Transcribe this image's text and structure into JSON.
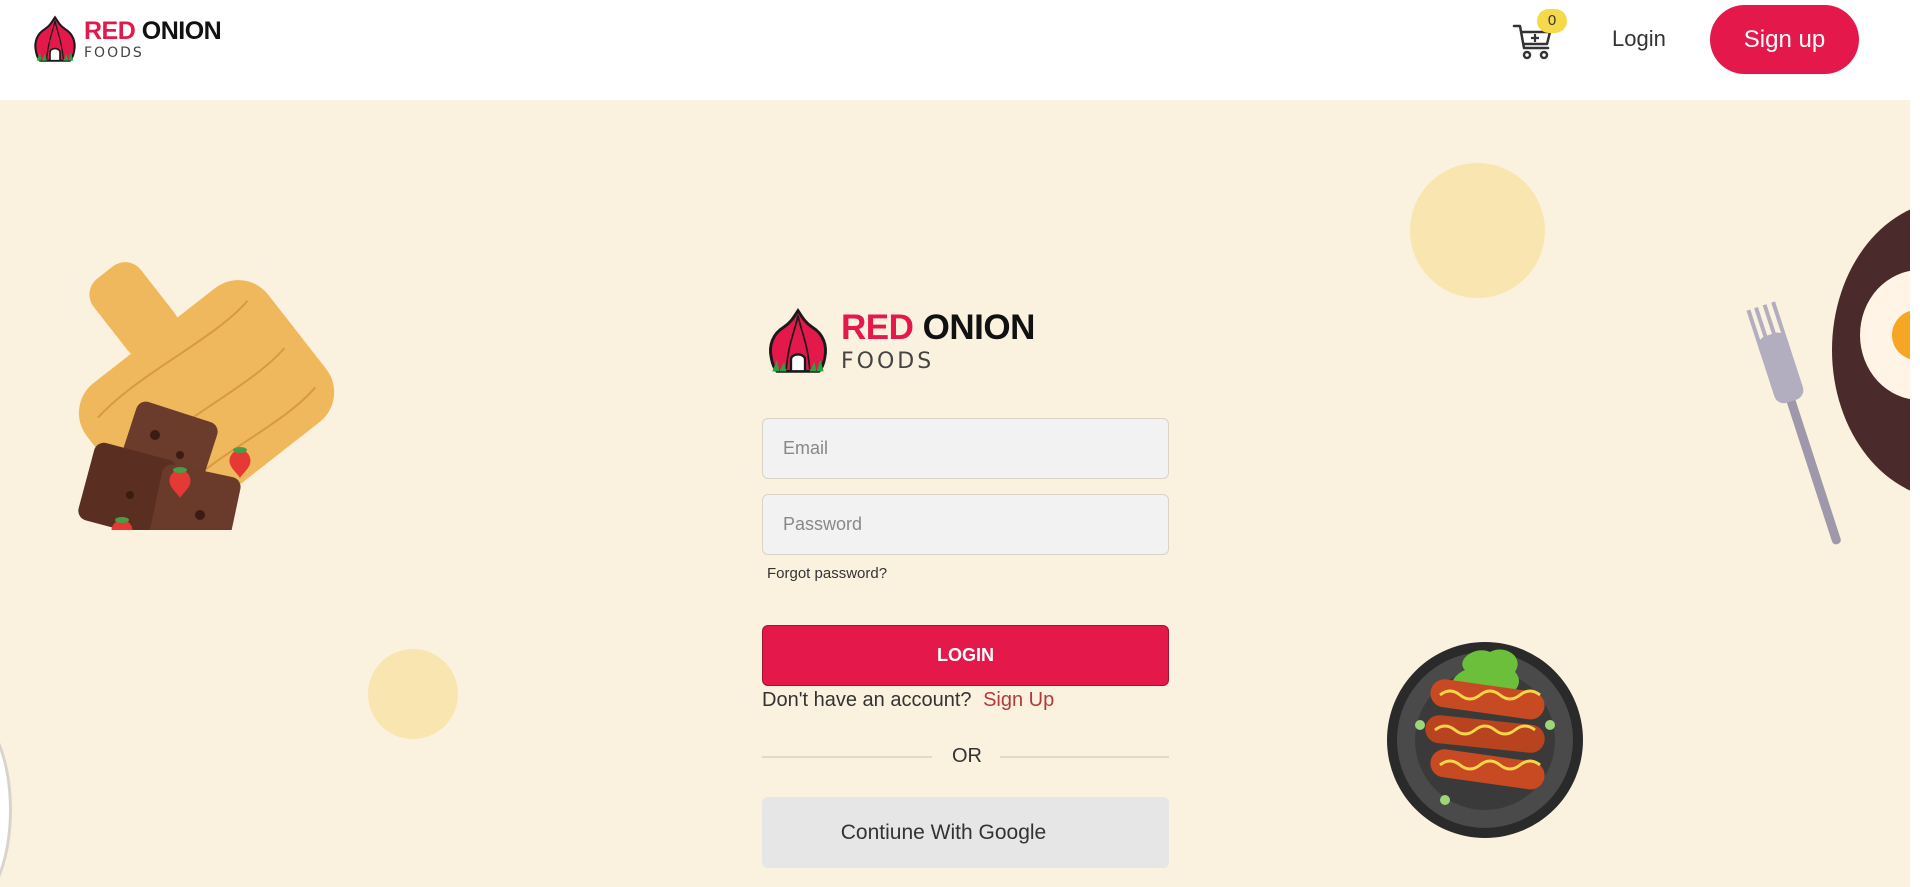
{
  "header": {
    "brand_word_1": "RED",
    "brand_word_2": "ONION",
    "brand_sub": "FOODS",
    "cart_count": "0",
    "login_label": "Login",
    "signup_label": "Sign up"
  },
  "form": {
    "brand_word_1": "RED",
    "brand_word_2": "ONION",
    "brand_sub": "FOODS",
    "email_placeholder": "Email",
    "password_placeholder": "Password",
    "forgot_label": "Forgot password?",
    "login_label": "LOGIN",
    "no_account_text": "Don't have an account?",
    "signup_link": "Sign Up",
    "or_text": "OR",
    "google_label": "Contiune With Google"
  },
  "colors": {
    "accent": "#e4184b",
    "hero_bg": "#fbf1df",
    "badge": "#f6d94a"
  },
  "icons": [
    "onion-logo-icon",
    "cart-icon"
  ]
}
